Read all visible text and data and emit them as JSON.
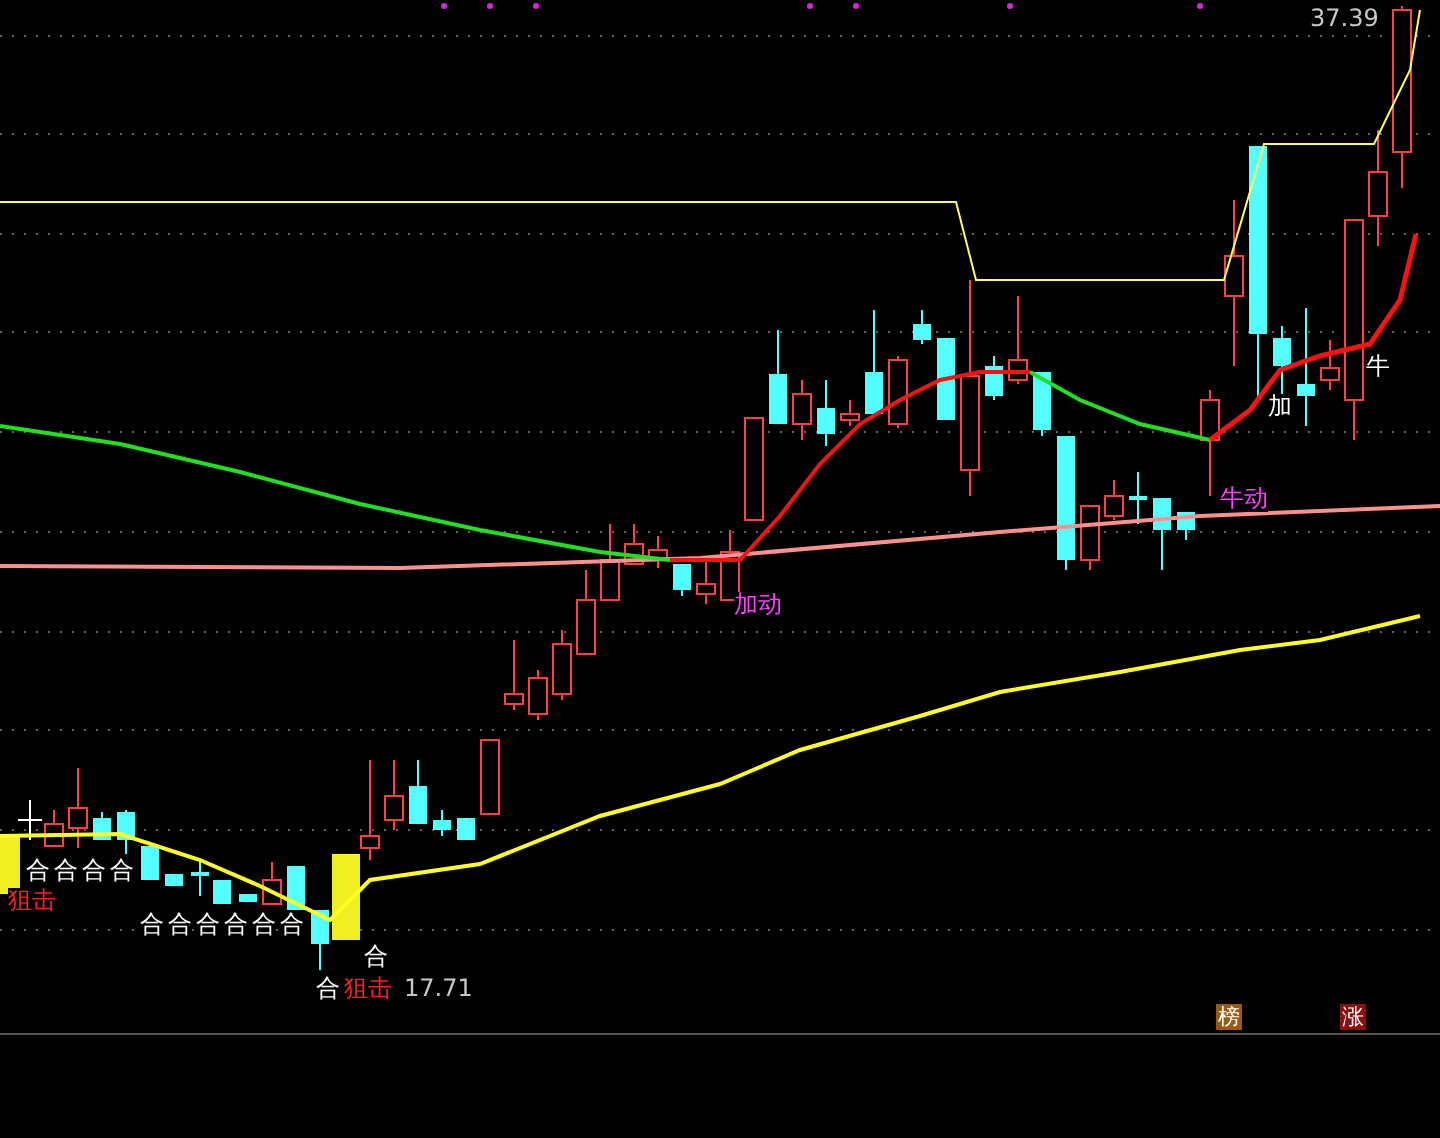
{
  "price_labels": [
    {
      "kind": "high",
      "text": "37.39"
    },
    {
      "kind": "low",
      "text": "17.71"
    }
  ],
  "signals": [
    {
      "kind": "combo",
      "text": "合"
    },
    {
      "kind": "combo",
      "text": "合"
    },
    {
      "kind": "combo",
      "text": "合"
    },
    {
      "kind": "combo",
      "text": "合"
    },
    {
      "kind": "combo",
      "text": "合"
    },
    {
      "kind": "combo",
      "text": "合"
    },
    {
      "kind": "combo",
      "text": "合"
    },
    {
      "kind": "combo",
      "text": "合"
    },
    {
      "kind": "combo",
      "text": "合"
    },
    {
      "kind": "combo",
      "text": "合"
    },
    {
      "kind": "combo",
      "text": "合"
    },
    {
      "kind": "combo",
      "text": "合"
    },
    {
      "kind": "buy",
      "text": "狙击"
    },
    {
      "kind": "buy",
      "text": "狙击"
    },
    {
      "kind": "move",
      "text": "加动"
    },
    {
      "kind": "move",
      "text": "牛动"
    },
    {
      "kind": "mark",
      "text": "加"
    },
    {
      "kind": "mark",
      "text": "牛"
    }
  ],
  "tags": [
    {
      "text": "榜",
      "color": "#9a5a14"
    },
    {
      "text": "涨",
      "color": "#8a1010"
    }
  ]
}
